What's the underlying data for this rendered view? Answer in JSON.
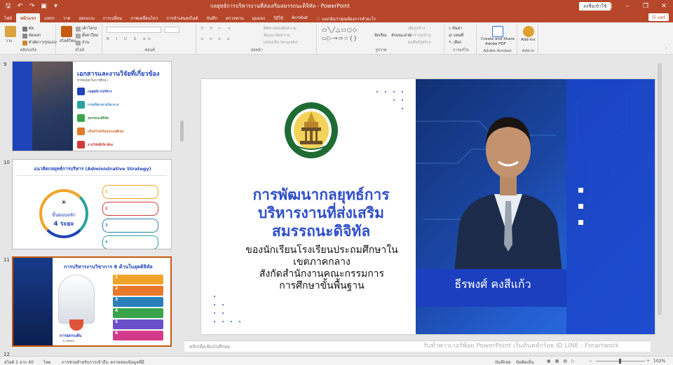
{
  "titlebar": {
    "doc_title": "กลยุทธ์การบริหารงานที่ส่งเสริมสมรรถนะดิจิทัล - PowerPoint",
    "signin": "ลงชื่อเข้าใช้"
  },
  "tabs": [
    "ไฟล์",
    "หน้าแรก",
    "แทรก",
    "วาด",
    "ออกแบบ",
    "การเปลี่ยน",
    "ภาพเคลื่อนไหว",
    "การนำเสนอสไลด์",
    "บันทึก",
    "ตรวจทาน",
    "มุมมอง",
    "วิธีใช้",
    "Acrobat"
  ],
  "active_tab": "หน้าแรก",
  "tell_me": "บอกฉันว่าคุณต้องการทำอะไร",
  "share_label": "แชร์",
  "ribbon": {
    "paste": "วาง",
    "cut": "ตัด",
    "copy": "คัดลอก",
    "format_painter": "ตัวคัดวางรูปแบบ",
    "clipboard": "คลิปบอร์ด",
    "new_slide": "สไลด์ใหม่",
    "layout": "เค้าโครง",
    "reset": "ตั้งค่าใหม่",
    "section": "ส่วน",
    "slides": "สไลด์",
    "font": "ฟอนต์",
    "paragraph": "ย่อหน้า",
    "text_direction": "ทิศทางของข้อความ",
    "align_text": "จัดแนวข้อความ",
    "smartart": "แปลงเป็น SmartArt",
    "arrange": "จัดเรียง",
    "quick_styles": "ลักษณะด่วน",
    "shape_fill": "เติมรูปร่าง",
    "shape_outline": "เค้าร่างรูปร่าง",
    "shape_effects": "ผลลัพธ์รูปร่าง",
    "drawing": "รูปวาด",
    "find": "ค้นหา",
    "replace": "แทนที่",
    "select": "เลือก",
    "editing": "การแก้ไข",
    "create_share_pdf_1": "Create and Share",
    "create_share_pdf_2": "Adobe PDF",
    "adobe_acrobat": "Adobe Acrobat",
    "addins": "Add-ins",
    "addin": "Add-in"
  },
  "thumbnails": [
    {
      "number": "9",
      "title": "เอกสารและงานวิจัยที่เกี่ยวข้อง",
      "subtitle": "หัวข้อหลักในการศึกษา",
      "items": [
        "กลยุทธ์การบริหาร",
        "การบริหารงานวิชาการ",
        "สมรรถนะดิจิทัล",
        "บริบทโรงเรียนประถมศึกษา",
        "งานวิจัยที่เกี่ยวข้อง"
      ]
    },
    {
      "number": "10",
      "title": "แนวคิดกลยุทธ์การบริหาร (Administrative Strategy)",
      "center_1": "ขั้นตอนหลัก",
      "center_2": "4 ระยะ",
      "steps": [
        "1",
        "2",
        "3",
        "4"
      ]
    },
    {
      "number": "11",
      "title": "การบริหารงานวิชาการ 6 ด้านในยุคดิจิทัล",
      "caption_1": "การยกระดับ",
      "caption_2": "ทางดิจิทัล",
      "steps": [
        "1",
        "2",
        "3",
        "4",
        "5",
        "6"
      ]
    },
    {
      "number": "12"
    }
  ],
  "slide": {
    "title_lines": [
      "การพัฒนากลยุทธ์การ",
      "บริหารงานที่ส่งเสริม",
      "สมรรถนะดิจิทัล"
    ],
    "subtitle_lines": [
      "ของนักเรียนโรงเรียนประถมศึกษาใน",
      "เขตภาคกลาง",
      "สังกัดสำนักงานคณะกรรมการ",
      "การศึกษาขั้นพื้นฐาน"
    ],
    "presenter": "ธีรพงศ์ คงสีแก้ว"
  },
  "notes_placeholder": "คลิกเพื่อเพิ่มบันทึกย่อ",
  "watermark": "รับทำพาวเวอร์พ้อย PowerPoint เริ่มต้นหลักร้อย ID LINE : Forartwork",
  "status": {
    "slide_count": "สไลด์ 1 จาก 40",
    "language": "ไทย",
    "accessibility": "การช่วยสำหรับการเข้าถึง: ตรวจสอบข้อมูลที่มี",
    "notes": "บันทึกย่อ",
    "comments": "ข้อคิดเห็น",
    "zoom": "102%"
  },
  "colors": {
    "accent": "#b7472a",
    "title_blue": "#2e4ec9",
    "presenter_band": "#1c3fbf"
  }
}
